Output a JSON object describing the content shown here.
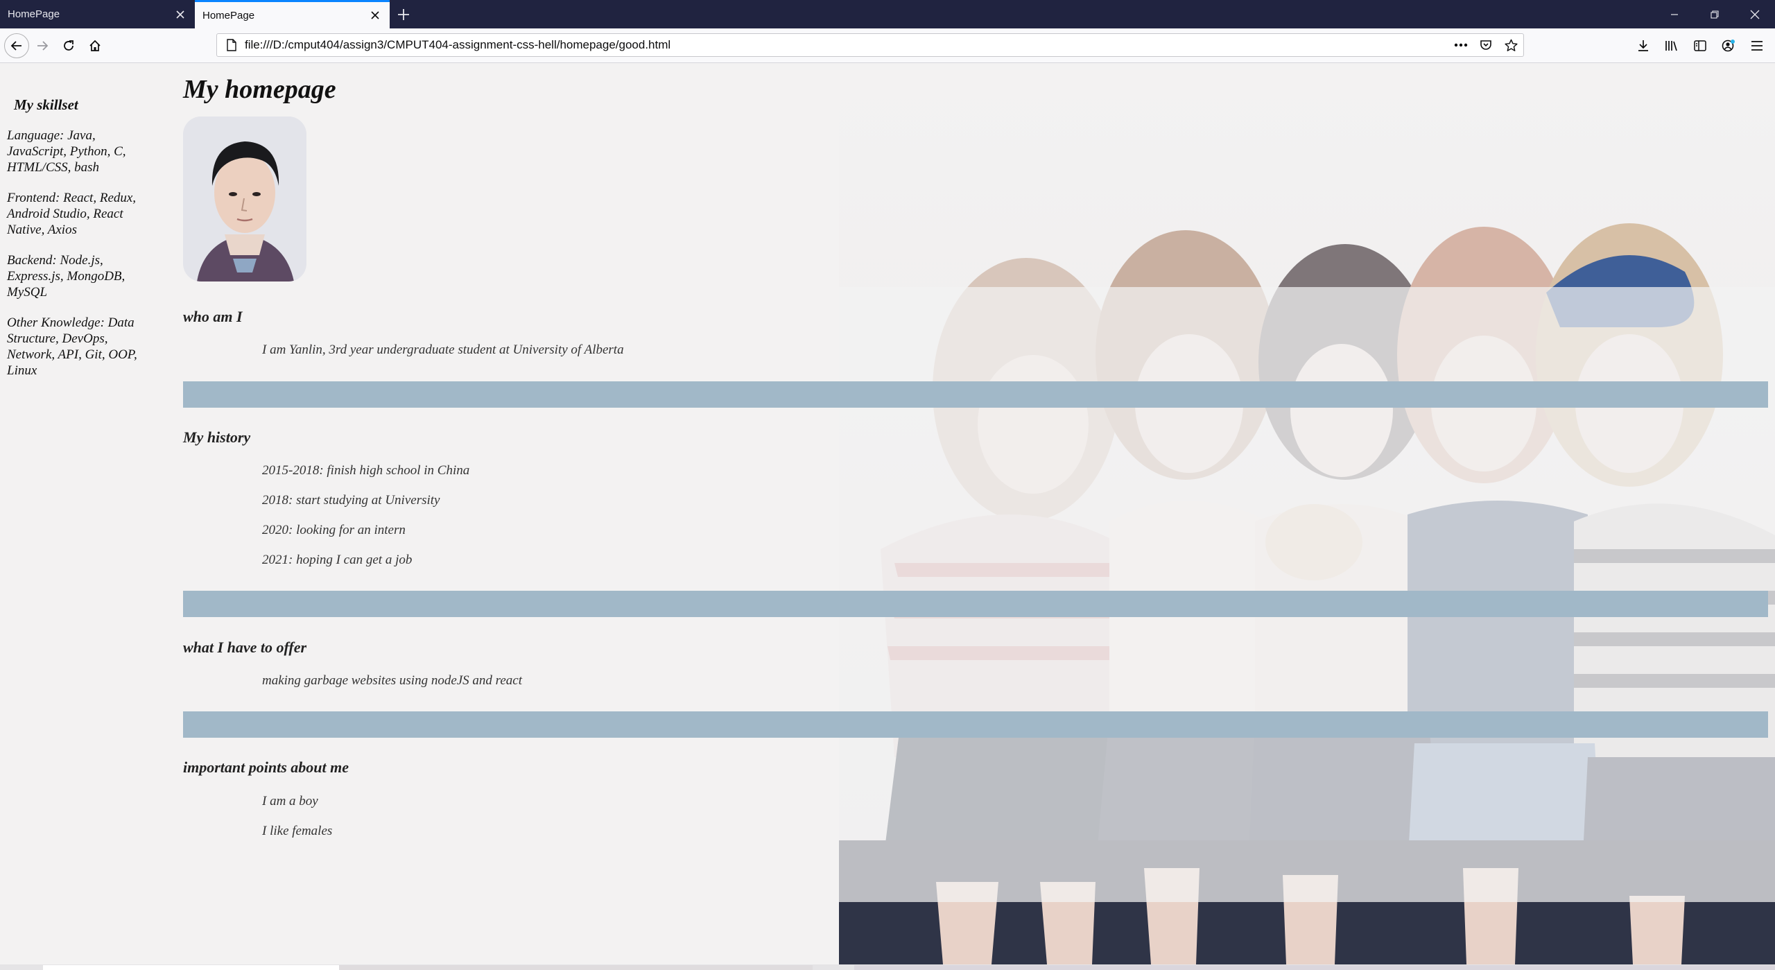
{
  "browser": {
    "tabs": [
      {
        "title": "HomePage",
        "active": false
      },
      {
        "title": "HomePage",
        "active": true
      }
    ],
    "url": "file:///D:/cmput404/assign3/CMPUT404-assignment-css-hell/homepage/good.html",
    "accent_color": "#0a84ff",
    "tabstrip_color": "#202340"
  },
  "page": {
    "title": "My homepage",
    "sidebar": {
      "heading": "My skillset",
      "items": [
        "Language: Java, JavaScript, Python, C, HTML/CSS, bash",
        "Frontend: React, Redux, Android Studio, React Native, Axios",
        "Backend: Node.js, Express.js, MongoDB, MySQL",
        "Other Knowledge: Data Structure, DevOps, Network, API, Git, OOP, Linux"
      ]
    },
    "sections": [
      {
        "title": "who am I",
        "items": [
          "I am Yanlin, 3rd year undergraduate student at University of Alberta"
        ]
      },
      {
        "title": "My history",
        "items": [
          "2015-2018: finish high school in China",
          "2018: start studying at University",
          "2020: looking for an intern",
          "2021: hoping I can get a job"
        ]
      },
      {
        "title": "what I have to offer",
        "items": [
          "making garbage websites using nodeJS and react"
        ]
      },
      {
        "title": "important points about me",
        "items": [
          "I am a boy",
          "I like females"
        ]
      }
    ],
    "divider_color": "#a1b8c8"
  }
}
